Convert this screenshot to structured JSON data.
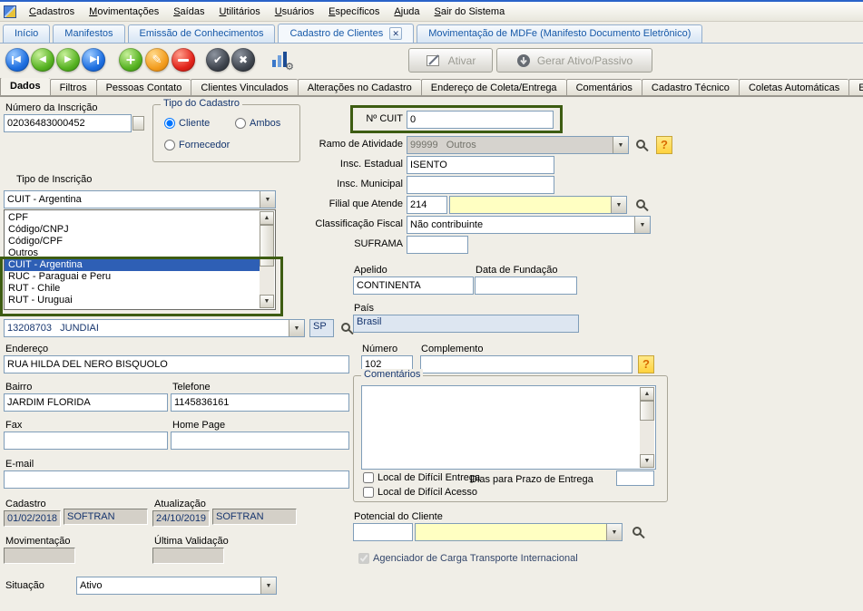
{
  "colors": {
    "annotation_green": "#3d5c12",
    "selection_blue": "#2e5fb5",
    "tab_text_blue": "#1558a8",
    "yellow_field": "#ffffc2"
  },
  "icons": {
    "help": "?",
    "close_tab": "✕",
    "confirm": "✔",
    "cancel": "✖",
    "edit": "✎",
    "add": "+",
    "nav_prev": "◀",
    "nav_next": "▶",
    "gear": "⚙"
  },
  "menu": {
    "items": [
      "Cadastros",
      "Movimentações",
      "Saídas",
      "Utilitários",
      "Usuários",
      "Específicos",
      "Ajuda",
      "Sair do Sistema"
    ]
  },
  "tabs": {
    "items": [
      "Início",
      "Manifestos",
      "Emissão de Conhecimentos",
      "Cadastro de Clientes",
      "Movimentação de MDFe (Manifesto Documento Eletrônico)"
    ],
    "active": "Cadastro de Clientes"
  },
  "toolbar": {
    "ativar_label": "Ativar",
    "gerar_label": "Gerar Ativo/Passivo"
  },
  "subtabs": {
    "items": [
      "Dados",
      "Filtros",
      "Pessoas Contato",
      "Clientes Vinculados",
      "Alterações no Cadastro",
      "Endereço de Coleta/Entrega",
      "Comentários",
      "Cadastro Técnico",
      "Coletas Automáticas",
      "Endereço de C"
    ],
    "active": "Dados"
  },
  "form": {
    "numero_inscricao": {
      "label": "Número da Inscrição",
      "value": "02036483000452"
    },
    "tipo_cadastro": {
      "legend": "Tipo do Cadastro",
      "cliente_label": "Cliente",
      "cliente_checked": true,
      "ambos_label": "Ambos",
      "ambos_checked": false,
      "fornecedor_label": "Fornecedor",
      "fornecedor_checked": false
    },
    "tipo_inscricao": {
      "label": "Tipo de Inscrição",
      "value": "CUIT - Argentina",
      "options": [
        "CPF",
        "Código/CNPJ",
        "Código/CPF",
        "Outros",
        "CUIT - Argentina",
        "RUC - Paraguai e Peru",
        "RUT - Chile",
        "RUT - Uruguai"
      ],
      "selected_index": 4
    },
    "cuit": {
      "label": "Nº CUIT",
      "value": "0"
    },
    "ramo_atividade": {
      "label": "Ramo de Atividade",
      "code": "99999",
      "name": "Outros"
    },
    "insc_estadual": {
      "label": "Insc. Estadual",
      "value": "ISENTO"
    },
    "insc_municipal": {
      "label": "Insc. Municipal",
      "value": ""
    },
    "filial_atende": {
      "label": "Filial que Atende",
      "code": "214",
      "name": ""
    },
    "classificacao_fiscal": {
      "label": "Classificação Fiscal",
      "value": "Não contribuinte"
    },
    "suframa": {
      "label": "SUFRAMA",
      "value": ""
    },
    "apelido": {
      "label": "Apelido",
      "value": "CONTINENTA"
    },
    "data_fundacao": {
      "label": "Data de Fundação",
      "value": ""
    },
    "pais": {
      "label": "País",
      "value": "Brasil"
    },
    "municipio": {
      "cep": "13208703",
      "cidade": "JUNDIAI",
      "uf": "SP"
    },
    "endereco": {
      "label": "Endereço",
      "value": "RUA HILDA DEL NERO BISQUOLO"
    },
    "numero": {
      "label": "Número",
      "value": "102"
    },
    "complemento": {
      "label": "Complemento",
      "value": ""
    },
    "bairro": {
      "label": "Bairro",
      "value": "JARDIM FLORIDA"
    },
    "telefone": {
      "label": "Telefone",
      "value": "1145836161"
    },
    "fax": {
      "label": "Fax",
      "value": ""
    },
    "home_page": {
      "label": "Home Page",
      "value": ""
    },
    "email": {
      "label": "E-mail",
      "value": ""
    },
    "comentarios": {
      "legend": "Comentários",
      "value": "",
      "dificil_entrega_label": "Local de Difícil Entrega",
      "dificil_entrega_checked": false,
      "dias_prazo_label": "Dias para Prazo de Entrega",
      "dias_prazo_value": "",
      "dificil_acesso_label": "Local de Difícil Acesso",
      "dificil_acesso_checked": false
    },
    "cadastro": {
      "label": "Cadastro",
      "date": "01/02/2018",
      "user": "SOFTRAN"
    },
    "atualizacao": {
      "label": "Atualização",
      "date": "24/10/2019",
      "user": "SOFTRAN"
    },
    "movimentacao": {
      "label": "Movimentação",
      "value": ""
    },
    "ultima_validacao": {
      "label": "Última Validação",
      "value": ""
    },
    "situacao": {
      "label": "Situação",
      "value": "Ativo"
    },
    "potencial_cliente": {
      "label": "Potencial do Cliente",
      "code": "",
      "name": ""
    },
    "agenciador": {
      "label": "Agenciador de Carga Transporte Internacional",
      "checked": true
    }
  }
}
